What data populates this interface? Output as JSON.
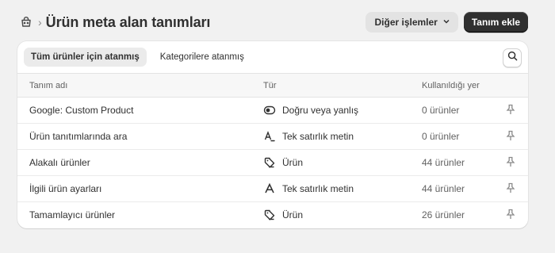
{
  "header": {
    "breadcrumb_icon": "product-icon",
    "title": "Ürün meta alan tanımları",
    "more_actions_label": "Diğer işlemler",
    "add_definition_label": "Tanım ekle"
  },
  "tabs": [
    {
      "label": "Tüm ürünler için atanmış",
      "active": true
    },
    {
      "label": "Kategorilere atanmış",
      "active": false
    }
  ],
  "table": {
    "columns": [
      "Tanım adı",
      "Tür",
      "Kullanıldığı yer"
    ],
    "rows": [
      {
        "name": "Google: Custom Product",
        "type": "Doğru veya yanlış",
        "type_icon": "toggle-icon",
        "usage": "0 ürünler"
      },
      {
        "name": "Ürün tanıtımlarında ara",
        "type": "Tek satırlık metin",
        "type_icon": "text-line-icon",
        "usage": "0 ürünler"
      },
      {
        "name": "Alakalı ürünler",
        "type": "Ürün",
        "type_icon": "product-tag-icon",
        "usage": "44 ürünler"
      },
      {
        "name": "İlgili ürün ayarları",
        "type": "Tek satırlık metin",
        "type_icon": "text-icon",
        "usage": "44 ürünler"
      },
      {
        "name": "Tamamlayıcı ürünler",
        "type": "Ürün",
        "type_icon": "product-tag-icon",
        "usage": "26 ürünler"
      }
    ]
  },
  "colors": {
    "background": "#f1f1f1",
    "card": "#ffffff",
    "primary_button": "#303030",
    "muted_text": "#616161"
  }
}
